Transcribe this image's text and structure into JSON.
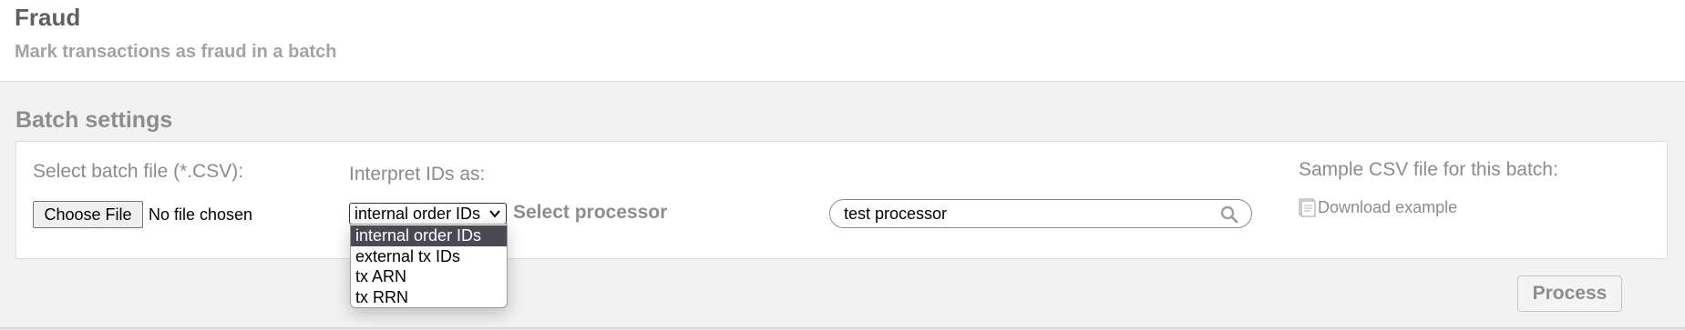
{
  "header": {
    "title": "Fraud",
    "subtitle": "Mark transactions as fraud in a batch"
  },
  "batch_settings": {
    "title": "Batch settings",
    "file_label": "Select batch file (*.CSV):",
    "choose_file_label": "Choose File",
    "file_status": "No file chosen",
    "interpret_label": "Interpret IDs as:",
    "interpret_selected": "internal order IDs",
    "interpret_options": [
      "internal order IDs",
      "external tx IDs",
      "tx ARN",
      "tx RRN"
    ],
    "select_processor_label": "Select processor",
    "processor_search_value": "test processor",
    "sample_label": "Sample CSV file for this batch:",
    "download_label": "Download example"
  },
  "actions": {
    "process_label": "Process"
  },
  "icons": {
    "select_chevron": "chevron-down-icon",
    "search": "search-icon",
    "download_file": "file-icon"
  },
  "colors": {
    "selected_option_bg": "#4a4a55",
    "panel_bg": "#f2f2f2",
    "muted_text": "#8d8d8d"
  }
}
